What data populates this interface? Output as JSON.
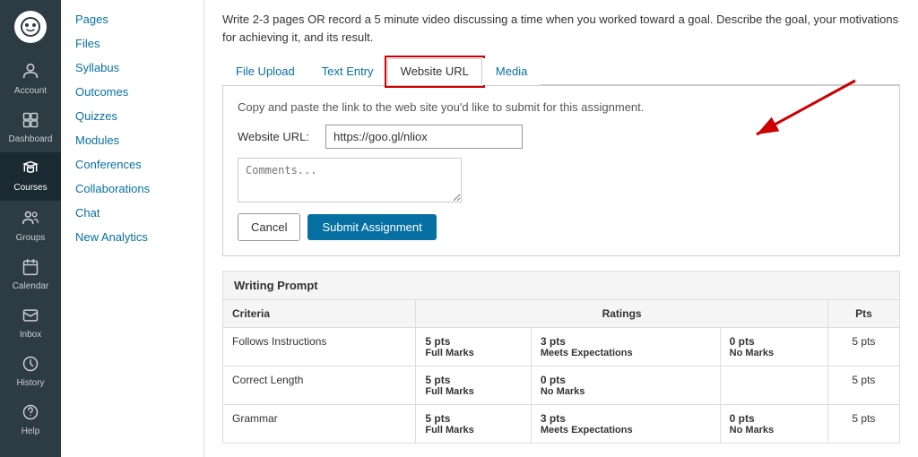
{
  "sidebar": {
    "logo": "🎨",
    "items": [
      {
        "id": "account",
        "label": "Account",
        "icon": "👤",
        "active": false
      },
      {
        "id": "dashboard",
        "label": "Dashboard",
        "icon": "⊞",
        "active": false
      },
      {
        "id": "courses",
        "label": "Courses",
        "icon": "📚",
        "active": true
      },
      {
        "id": "groups",
        "label": "Groups",
        "icon": "👥",
        "active": false
      },
      {
        "id": "calendar",
        "label": "Calendar",
        "icon": "📅",
        "active": false
      },
      {
        "id": "inbox",
        "label": "Inbox",
        "icon": "✉",
        "active": false
      },
      {
        "id": "history",
        "label": "History",
        "icon": "🕐",
        "active": false
      },
      {
        "id": "help",
        "label": "Help",
        "icon": "?",
        "active": false
      }
    ]
  },
  "subnav": {
    "items": [
      {
        "label": "Pages"
      },
      {
        "label": "Files"
      },
      {
        "label": "Syllabus"
      },
      {
        "label": "Outcomes"
      },
      {
        "label": "Quizzes"
      },
      {
        "label": "Modules"
      },
      {
        "label": "Conferences"
      },
      {
        "label": "Collaborations"
      },
      {
        "label": "Chat"
      },
      {
        "label": "New Analytics"
      }
    ]
  },
  "main": {
    "description": "Write 2-3 pages OR record a 5 minute video discussing a time when you worked toward a goal. Describe the goal, your motivations for achieving it, and its result.",
    "tabs": [
      {
        "label": "File Upload",
        "active": false
      },
      {
        "label": "Text Entry",
        "active": false
      },
      {
        "label": "Website URL",
        "active": true
      },
      {
        "label": "Media",
        "active": false
      }
    ],
    "submit_box": {
      "description": "Copy and paste the link to the web site you'd like to submit for this assignment.",
      "url_label": "Website URL:",
      "url_value": "https://goo.gl/nliox",
      "url_placeholder": "https://goo.gl/nliox",
      "comments_placeholder": "Comments...",
      "cancel_label": "Cancel",
      "submit_label": "Submit Assignment"
    },
    "rubric": {
      "title": "Writing Prompt",
      "col_criteria": "Criteria",
      "col_ratings": "Ratings",
      "col_pts": "Pts",
      "rows": [
        {
          "criteria": "Follows Instructions",
          "ratings": [
            {
              "pts": "5 pts",
              "label": "Full Marks"
            },
            {
              "pts": "3 pts",
              "label": "Meets Expectations"
            },
            {
              "pts": "0 pts",
              "label": "No Marks"
            }
          ],
          "pts": "5 pts"
        },
        {
          "criteria": "Correct Length",
          "ratings": [
            {
              "pts": "5 pts",
              "label": "Full Marks"
            },
            {
              "pts": "0 pts",
              "label": "No Marks"
            }
          ],
          "pts": "5 pts"
        },
        {
          "criteria": "Grammar",
          "ratings": [
            {
              "pts": "5 pts",
              "label": "Full Marks"
            },
            {
              "pts": "3 pts",
              "label": "Meets Expectations"
            },
            {
              "pts": "0 pts",
              "label": "No Marks"
            }
          ],
          "pts": "5 pts"
        }
      ]
    }
  }
}
